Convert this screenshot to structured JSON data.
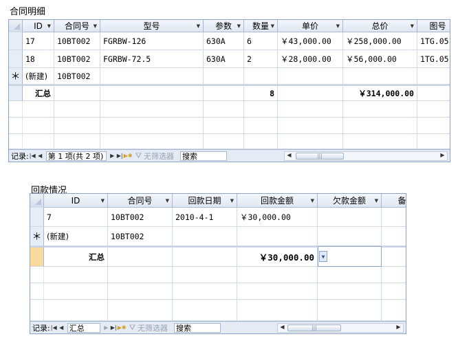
{
  "contract": {
    "title": "合同明细",
    "columns": [
      "ID",
      "合同号",
      "型号",
      "参数",
      "数量",
      "单价",
      "总价",
      "图号"
    ],
    "rows": [
      [
        "17",
        "10BT002",
        "FGRBW-126",
        "630A",
        "6",
        "￥43,000.00",
        "￥258,000.00",
        "1TG.05"
      ],
      [
        "18",
        "10BT002",
        "FGRBW-72.5",
        "630A",
        "2",
        "￥28,000.00",
        "￥56,000.00",
        "1TG.05"
      ]
    ],
    "new_row": {
      "marker": "＊",
      "id": "(新建)",
      "contract_no": "10BT002"
    },
    "totals": {
      "label": "汇总",
      "quantity": "8",
      "total_price": "￥314,000.00"
    },
    "nav": {
      "record_label": "记录:",
      "position": "第 1 项(共 2 项)",
      "filter": "无筛选器",
      "search": "搜索"
    }
  },
  "payment": {
    "title": "回款情况",
    "columns": [
      "ID",
      "合同号",
      "回款日期",
      "回款金额",
      "欠款金额",
      "备"
    ],
    "rows": [
      [
        "7",
        "10BT002",
        "2010-4-1",
        "￥30,000.00",
        "",
        ""
      ]
    ],
    "new_row": {
      "marker": "＊",
      "id": "(新建)",
      "contract_no": "10BT002"
    },
    "totals": {
      "label": "汇总",
      "amount": "￥30,000.00"
    },
    "nav": {
      "record_label": "记录:",
      "position": "汇总",
      "filter": "无筛选器",
      "search": "搜索"
    }
  },
  "icons": {
    "nav_first": "first-record-icon",
    "nav_prev": "previous-record-icon",
    "nav_next": "next-record-icon",
    "nav_last": "last-record-icon",
    "nav_new": "new-record-icon",
    "filter": "funnel-icon",
    "sort": "sort-arrow-icon",
    "dropdown": "chevron-down-icon"
  },
  "colors": {
    "grid_border": "#8ea4c4",
    "header_bg": "#dfe7f3",
    "selected_row": "#f9d99c"
  }
}
